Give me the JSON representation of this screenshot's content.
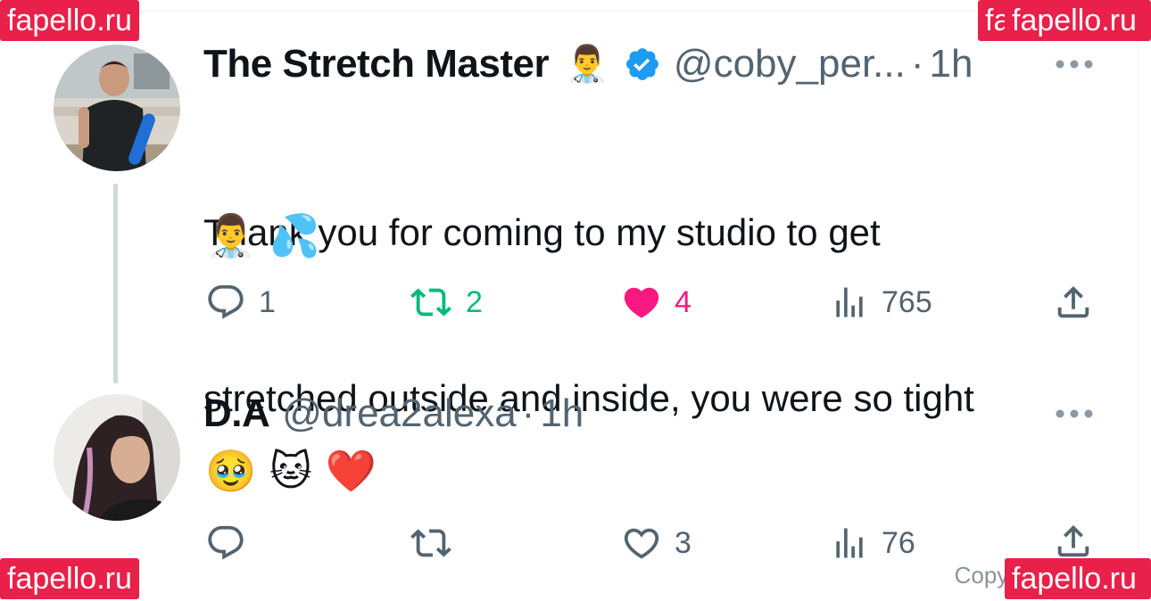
{
  "colors": {
    "text_primary": "#0f1419",
    "text_secondary": "#536471",
    "verified_blue": "#1d9bf0",
    "retweet_green": "#00ba7c",
    "like_pink": "#f91880",
    "thread_line": "#cfd9de",
    "watermark_red": "#e8204a"
  },
  "watermarks": {
    "top_left": "fapello.ru",
    "top_right": "fapello.ru",
    "top_right_overlap": "fa",
    "bottom_left": "fapello.ru",
    "bottom_right": "fapello.ru"
  },
  "copyright": "Copyright Dre",
  "tweets": [
    {
      "display_name": "The Stretch Master",
      "name_emoji": "👨‍⚕️",
      "verified": true,
      "handle": "@coby_per...",
      "separator": "·",
      "time": "1h",
      "text_lines": [
        "Thank you for coming to my studio to get",
        "stretched outside and inside, you were so tight"
      ],
      "emoji_line": "👨‍⚕️ 💦",
      "actions": {
        "replies": "1",
        "retweets": "2",
        "likes": "4",
        "views": "765"
      },
      "retweeted": true,
      "liked": true,
      "icons": [
        "reply-icon",
        "retweet-icon",
        "heart-filled-icon",
        "views-icon",
        "share-icon",
        "more-icon",
        "verified-badge-icon"
      ]
    },
    {
      "display_name": "D.A",
      "handle": "@drea2alexa",
      "separator": "·",
      "time": "1h",
      "emoji_line": "🥹 🐱 ❤️",
      "actions": {
        "replies": "",
        "retweets": "",
        "likes": "3",
        "views": "76"
      },
      "retweeted": false,
      "liked": false,
      "icons": [
        "reply-icon",
        "retweet-icon",
        "heart-outline-icon",
        "views-icon",
        "share-icon",
        "more-icon"
      ]
    }
  ]
}
